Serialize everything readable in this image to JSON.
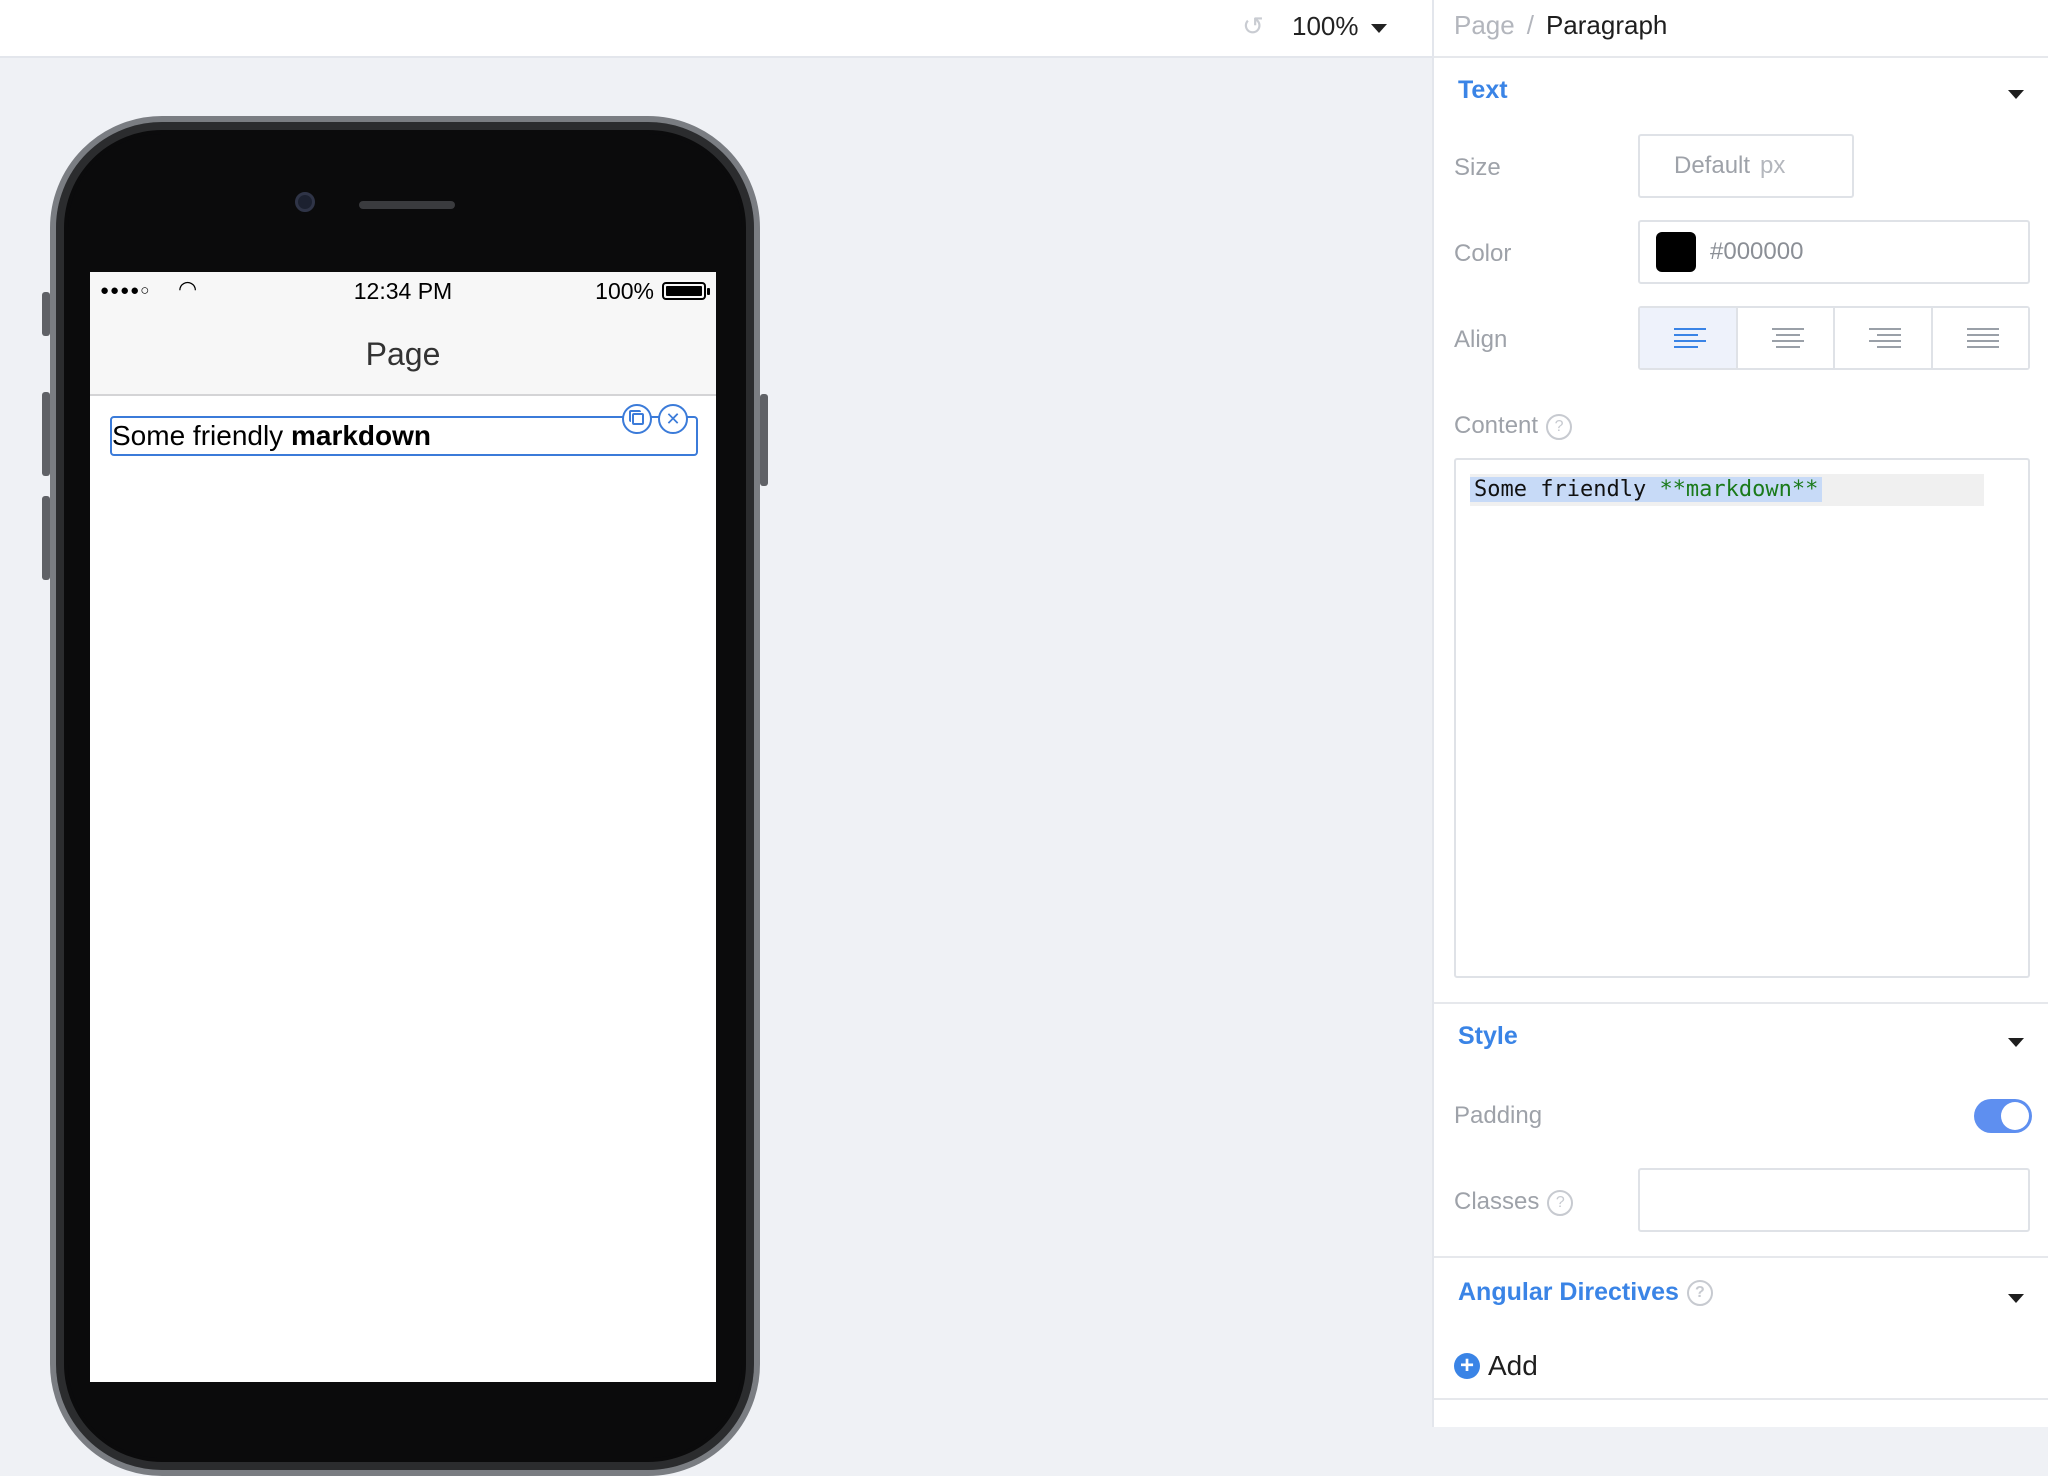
{
  "toolbar": {
    "zoom_value": "100%",
    "undo_icon": "undo-icon",
    "zoom_caret_icon": "chevron-down-icon"
  },
  "device": {
    "status": {
      "signal": "●●●●○",
      "time": "12:34 PM",
      "battery": "100%"
    },
    "nav_title": "Page",
    "paragraph": {
      "text_normal": "Some friendly ",
      "text_bold": "markdown"
    }
  },
  "inspector": {
    "breadcrumb": {
      "parent": "Page",
      "separator": "/",
      "current": "Paragraph"
    },
    "text_section": {
      "title": "Text",
      "size_label": "Size",
      "size_placeholder": "Default",
      "size_unit": "px",
      "color_label": "Color",
      "color_value": "#000000",
      "align_label": "Align",
      "align_options": [
        "left",
        "center",
        "right",
        "justify"
      ],
      "align_selected": "left",
      "content_label": "Content",
      "content_plain": "Some friendly ",
      "content_markdown": "**markdown**"
    },
    "style_section": {
      "title": "Style",
      "padding_label": "Padding",
      "padding_enabled": true,
      "classes_label": "Classes",
      "classes_value": ""
    },
    "directives_section": {
      "title": "Angular Directives",
      "add_label": "Add"
    }
  },
  "colors": {
    "accent": "#3a84e6",
    "toggle_on": "#5e8ff0",
    "selection_border": "#3b7bd9",
    "markdown_syntax": "#1a7a1a"
  }
}
